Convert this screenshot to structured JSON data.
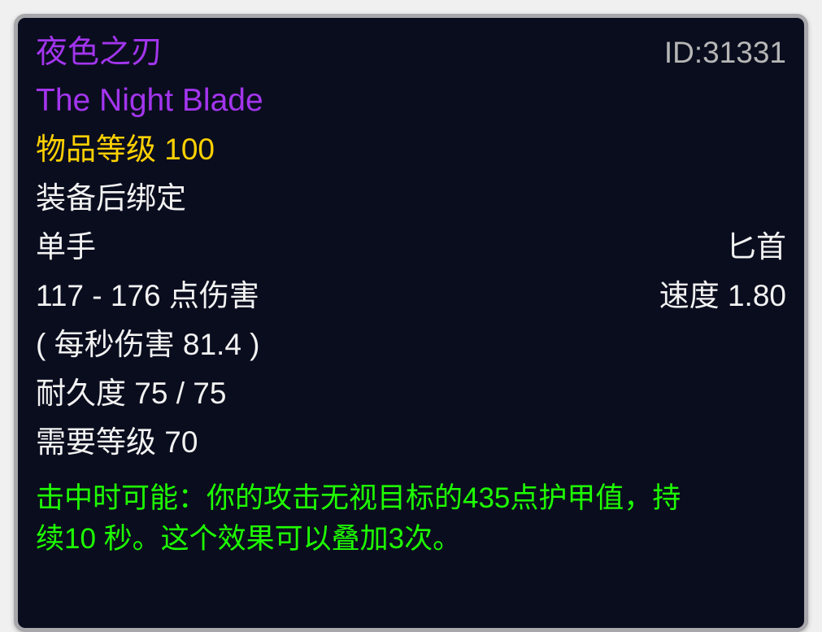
{
  "tooltip": {
    "item_name_cn": "夜色之刃",
    "item_id_label": "ID:31331",
    "item_name_en": "The Night Blade",
    "item_level": "物品等级 100",
    "bind_type": "装备后绑定",
    "hand_type": "单手",
    "weapon_type": "匕首",
    "damage": "117 - 176 点伤害",
    "speed": "速度 1.80",
    "dps": "( 每秒伤害 81.4 )",
    "durability": "耐久度 75 / 75",
    "required_level": "需要等级 70",
    "effect_line_1": "击中时可能：你的攻击无视目标的435点护甲值，持",
    "effect_line_2": "续10 秒。这个效果可以叠加3次。"
  },
  "colors": {
    "epic_purple": "#a335ee",
    "item_level_gold": "#ffd100",
    "body_white": "#f2f2f2",
    "id_gray": "#b6b6b6",
    "effect_green": "#1eff00",
    "panel_background": "#0a0d1e",
    "panel_border": "#a8a8ac",
    "page_background": "#f0f0f0"
  }
}
